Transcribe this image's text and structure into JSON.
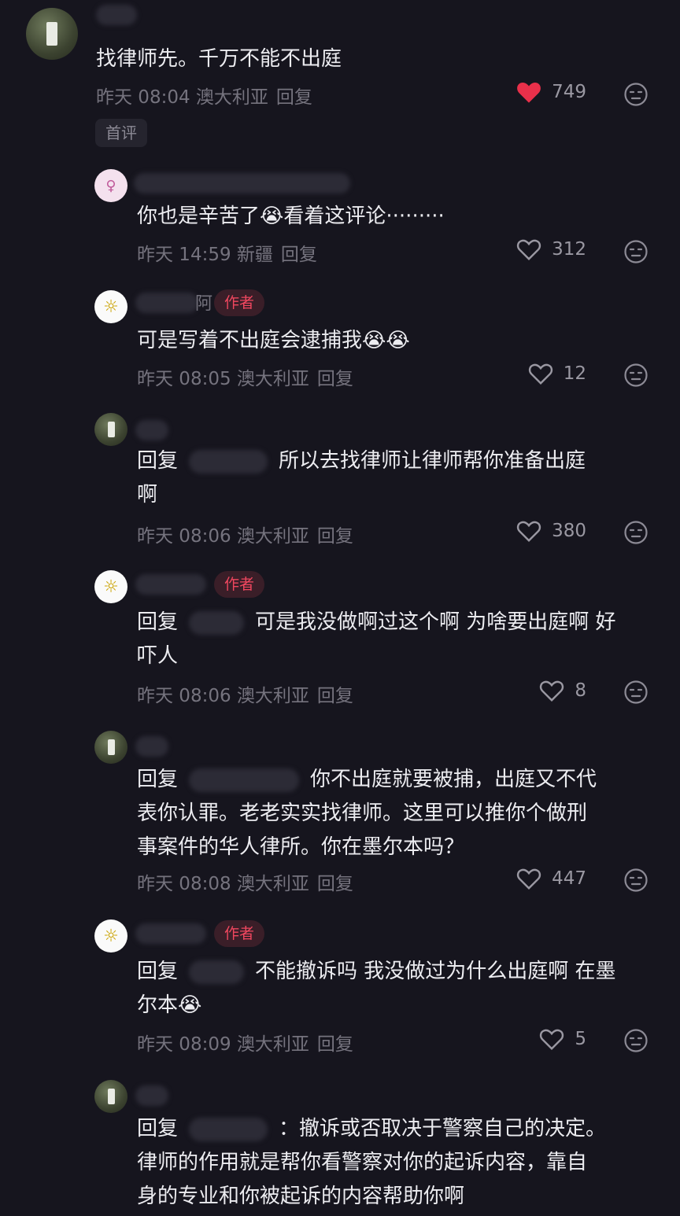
{
  "top": {
    "text": "找律师先。千万不能不出庭",
    "time": "昨天 08:04 澳大利亚",
    "reply": "回复",
    "likes": "749",
    "tag": "首评"
  },
  "replies": [
    {
      "text": "你也是辛苦了😭看着这评论·········",
      "time": "昨天 14:59 新疆",
      "reply": "回复",
      "likes": "312"
    },
    {
      "author_badge": "作者",
      "name_tail": "阿",
      "text": "可是写着不出庭会逮捕我😭😭",
      "time": "昨天 08:05 澳大利亚",
      "reply": "回复",
      "likes": "12"
    },
    {
      "prefix": "回复",
      "text": "所以去找律师让律师帮你准备出庭\n啊",
      "time": "昨天 08:06 澳大利亚",
      "reply": "回复",
      "likes": "380"
    },
    {
      "author_badge": "作者",
      "prefix": "回复",
      "text": "可是我没做啊过这个啊 为啥要出庭啊 好\n吓人",
      "time": "昨天 08:06 澳大利亚",
      "reply": "回复",
      "likes": "8"
    },
    {
      "prefix": "回复",
      "text": "你不出庭就要被捕，出庭又不代\n表你认罪。老老实实找律师。这里可以推你个做刑\n事案件的华人律所。你在墨尔本吗？",
      "time": "昨天 08:08 澳大利亚",
      "reply": "回复",
      "likes": "447"
    },
    {
      "author_badge": "作者",
      "prefix": "回复",
      "text": "不能撤诉吗 我没做过为什么出庭啊 在墨\n尔本😭",
      "time": "昨天 08:09 澳大利亚",
      "reply": "回复",
      "likes": "5"
    },
    {
      "prefix": "回复",
      "text": "：撤诉或否取决于警察自己的决定。\n律师的作用就是帮你看警察对你的起诉内容，靠自\n身的专业和你被起诉的内容帮助你啊"
    }
  ],
  "colors": {
    "liked_heart": "#e8304a",
    "author_badge": "#f0475f",
    "background": "#16151e"
  }
}
